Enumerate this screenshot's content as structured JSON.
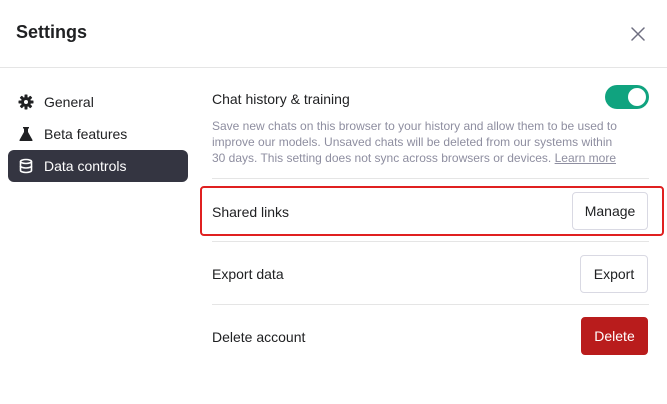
{
  "dialog": {
    "title": "Settings",
    "close_icon": "close-icon"
  },
  "sidebar": {
    "items": [
      {
        "label": "General",
        "icon": "gear-icon",
        "active": false
      },
      {
        "label": "Beta features",
        "icon": "flask-icon",
        "active": false
      },
      {
        "label": "Data controls",
        "icon": "database-icon",
        "active": true
      }
    ]
  },
  "data_controls": {
    "chat_history": {
      "title": "Chat history & training",
      "description": "Save new chats on this browser to your history and allow them to be used to improve our models. Unsaved chats will be deleted from our systems within 30 days. This setting does not sync across browsers or devices.",
      "learn_more": "Learn more",
      "enabled": true
    },
    "shared_links": {
      "title": "Shared links",
      "button": "Manage"
    },
    "export_data": {
      "title": "Export data",
      "button": "Export"
    },
    "delete_account": {
      "title": "Delete account",
      "button": "Delete"
    }
  },
  "colors": {
    "toggle_on": "#10a37f",
    "active_nav": "#343541",
    "danger": "#b91c1c",
    "highlight": "#e02020"
  }
}
